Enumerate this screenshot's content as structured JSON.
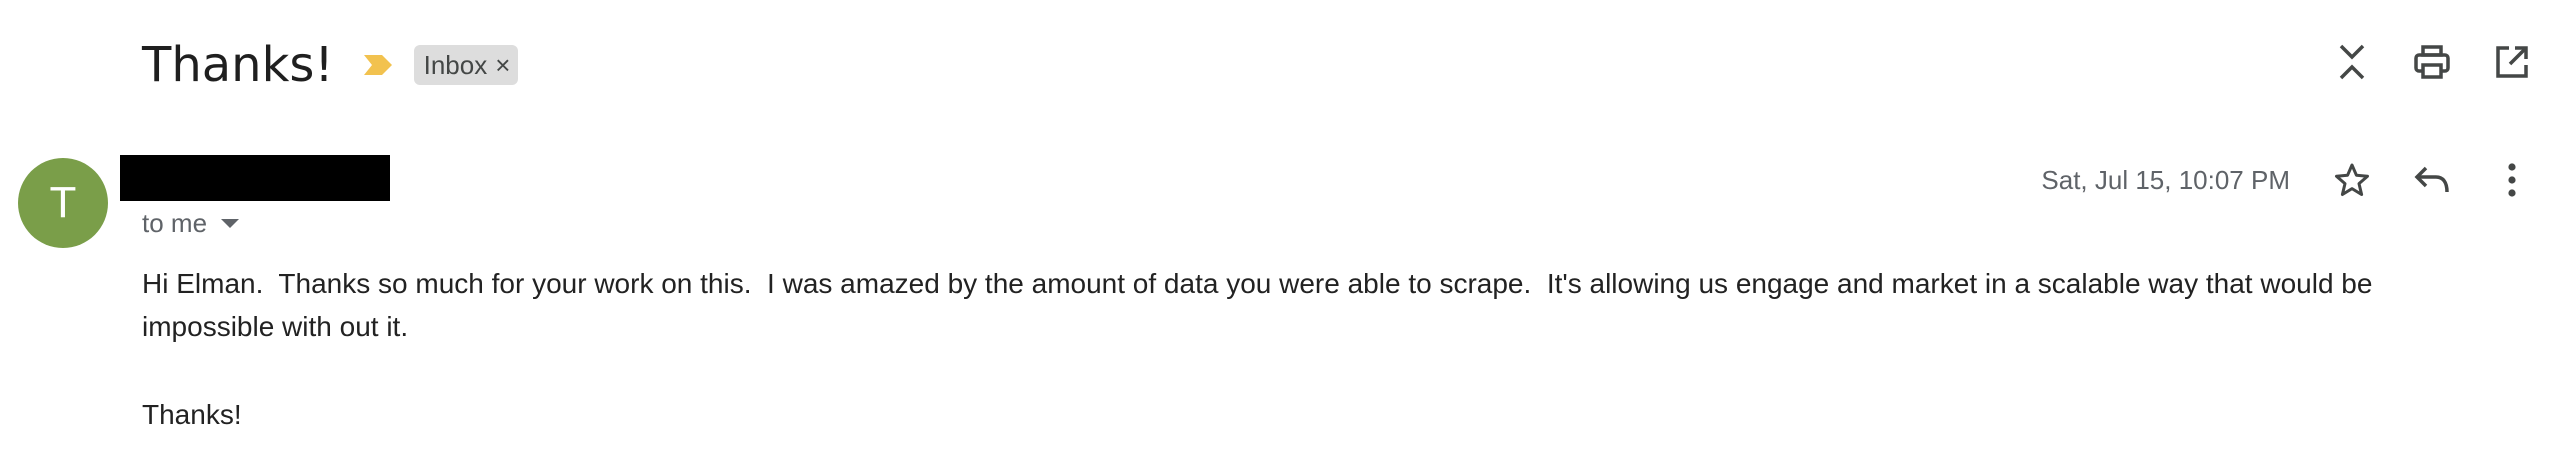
{
  "message": {
    "subject": "Thanks!",
    "label": "Inbox",
    "label_remove": "×",
    "sender_initial": "T",
    "recipient_text": "to me",
    "date": "Sat, Jul 15, 10:07 PM",
    "body": "Hi Elman.  Thanks so much for your work on this.  I was amazed by the amount of data you were able to scrape.  It's allowing us engage and market in a scalable way that would be impossible with out it.",
    "signoff": "Thanks!"
  },
  "icons": {
    "importance": "importance-marker-icon",
    "collapse": "collapse-all-icon",
    "print": "print-icon",
    "open_new": "open-in-new-window-icon",
    "star": "star-icon",
    "reply": "reply-icon",
    "more": "more-vertical-icon",
    "recipient_details": "chevron-down-icon"
  },
  "colors": {
    "avatar_bg": "#7a9e49",
    "importance": "#f2c24f",
    "chip_bg": "#dddddd",
    "redaction": "#000000"
  }
}
